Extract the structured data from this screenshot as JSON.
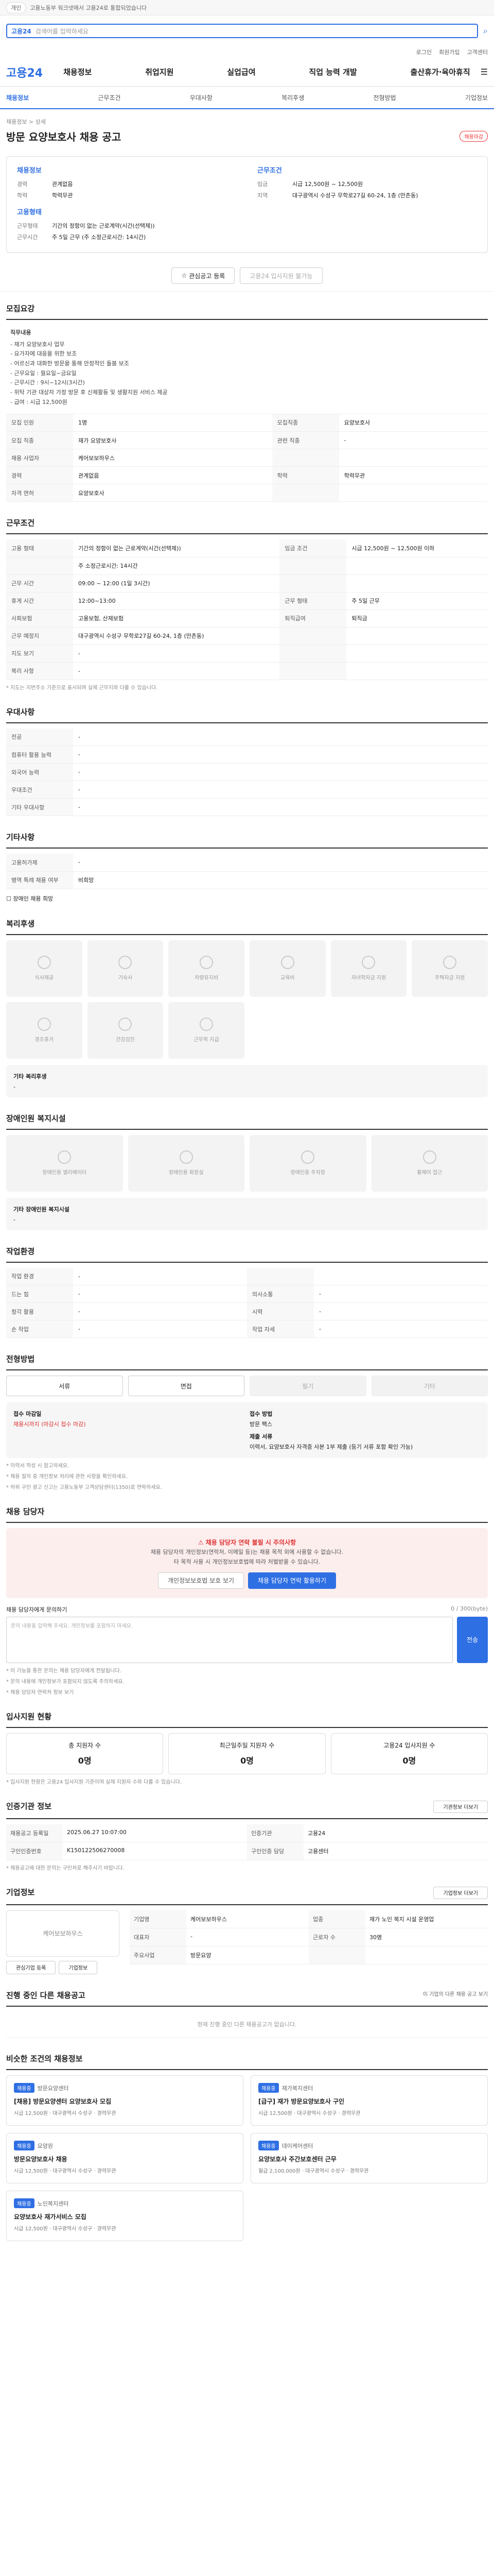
{
  "topbar": {
    "notice": "고용노동부 워크넷에서 고용24로 통합되었습니다",
    "pill": "개인"
  },
  "search": {
    "tag": "고용24",
    "placeholder": "검색어를 입력하세요"
  },
  "toplinks": [
    "로그인",
    "회원가입",
    "고객센터"
  ],
  "nav": {
    "logo": "고용24",
    "items": [
      "채용정보",
      "취업지원",
      "실업급여",
      "직업 능력 개발",
      "출산휴가·육아휴직"
    ]
  },
  "subtabs": [
    "채용정보",
    "근무조건",
    "우대사항",
    "복리후생",
    "전형방법",
    "기업정보"
  ],
  "posting": {
    "crumb": "채용정보 > 상세",
    "title": "방문 요양보호사 채용 공고",
    "badge": "채용마감"
  },
  "info_left": {
    "heading": "채용정보",
    "rows": [
      {
        "k": "경력",
        "v": "관계없음"
      },
      {
        "k": "학력",
        "v": "학력무관"
      }
    ],
    "heading2": "고용형태",
    "rows2": [
      {
        "k": "근무형태",
        "v": "기간의 정함이 없는 근로계약(시간(선택제))"
      },
      {
        "k": "근무시간",
        "v": "주 5일 근무 (주 소정근로시간: 14시간)"
      }
    ]
  },
  "info_right": {
    "heading": "근무조건",
    "rows": [
      {
        "k": "임금",
        "v": "시급 12,500원 ~ 12,500원"
      },
      {
        "k": "지역",
        "v": "대구광역시 수성구 무학로27길 60-24, 1층 (만촌동)"
      }
    ]
  },
  "actions": {
    "scrap": "관심공고 등록",
    "share": "고용24 입사지원 불가능"
  },
  "sec_job": {
    "title": "모집요강",
    "desc_head": "직무내용",
    "desc": [
      "- 재가 요양보호사 업무",
      "- 요가자에 대응을 위한 보조",
      "- 어르신과 대화한 방문을 통해 안정적인 돌봄 보조",
      "- 근무요일 : 월요일~금요일",
      "- 근무시간 : 9시~12시(3시간)",
      "- 위탁 기관 대상자 가정 방문 후 신체활동 및 생활지원 서비스 제공",
      "- 급여 : 시급 12,500원"
    ]
  },
  "job_table": [
    {
      "k": "모집 인원",
      "v": "1명",
      "k2": "모집직종",
      "v2": "요양보호사"
    },
    {
      "k": "모집 직종",
      "v": "재가 요양보호사",
      "k2": "관련 직종",
      "v2": "-"
    },
    {
      "k": "채용 사업자",
      "v": "케어보보하우스",
      "k2": "",
      "v2": ""
    },
    {
      "k": "경력",
      "v": "관계없음",
      "k2": "학력",
      "v2": "학력무관"
    },
    {
      "k": "자격 면허",
      "v": "요양보호사",
      "k2": "",
      "v2": ""
    }
  ],
  "sec_cond": {
    "title": "근무조건"
  },
  "cond_table": [
    {
      "k": "고용 형태",
      "v": "기간의 정함이 없는 근로계약(시간(선택제))",
      "k2": "임금 조건",
      "v2": "시급 12,500원 ~ 12,500원 이하"
    },
    {
      "k": "",
      "v": "주 소정근로시간: 14시간",
      "k2": "",
      "v2": ""
    },
    {
      "k": "근무 시간",
      "v": "09:00 ~ 12:00 (1일 3시간)",
      "k2": "",
      "v2": ""
    },
    {
      "k": "휴게 시간",
      "v": "12:00~13:00",
      "k2": "근무 형태",
      "v2": "주 5일 근무"
    },
    {
      "k": "사회보험",
      "v": "고용보험, 산재보험",
      "k2": "퇴직급여",
      "v2": "퇴직금"
    },
    {
      "k": "근무 예정지",
      "v": "대구광역시 수성구 무학로27길 60-24, 1층 (만촌동)",
      "k2": "",
      "v2": ""
    },
    {
      "k": "지도 보기",
      "v": "-",
      "k2": "",
      "v2": ""
    },
    {
      "k": "복리 사항",
      "v": "-",
      "k2": "",
      "v2": ""
    }
  ],
  "cond_note": "* 지도는 지번주소 기준으로 표시되며 실제 근무지와 다를 수 있습니다.",
  "sec_pref": {
    "title": "우대사항"
  },
  "pref_table": [
    {
      "k": "전공",
      "v": "-"
    },
    {
      "k": "컴퓨터 활용 능력",
      "v": "-"
    },
    {
      "k": "외국어 능력",
      "v": "-"
    },
    {
      "k": "우대조건",
      "v": "-"
    },
    {
      "k": "기타 우대사항",
      "v": "-"
    }
  ],
  "sec_etc": {
    "title": "기타사항"
  },
  "etc_table": [
    {
      "k": "고용허가제",
      "v": "-"
    },
    {
      "k": "병역 특례 채용 여부",
      "v": "비희망"
    }
  ],
  "etc_check": "장애인 채용 희망",
  "sec_welfare": {
    "title": "복리후생"
  },
  "welfare_tiles": [
    "식사제공",
    "기숙사",
    "차량유지비",
    "교육비",
    "자녀학자금 지원",
    "주택자금 지원",
    "경조휴가",
    "건강검진",
    "근무복 지급"
  ],
  "welfare_note_head": "기타 복리후생",
  "welfare_note": "-",
  "sec_disab": {
    "title": "장애인원 복지시설"
  },
  "disab_tiles": [
    "장애인용 엘리베이터",
    "장애인용 화장실",
    "장애인용 주차장",
    "휠체어 접근"
  ],
  "disab_note_head": "기타 장애인원 복지시설",
  "disab_note": "-",
  "sec_env": {
    "title": "작업환경"
  },
  "env_table": [
    {
      "k": "작업 환경",
      "v": "-",
      "k2": "",
      "v2": ""
    },
    {
      "k": "드는 힘",
      "v": "-",
      "k2": "의사소통",
      "v2": "-"
    },
    {
      "k": "청각 활용",
      "v": "-",
      "k2": "시력",
      "v2": "-"
    },
    {
      "k": "손 작업",
      "v": "-",
      "k2": "작업 자세",
      "v2": "-"
    }
  ],
  "sec_method": {
    "title": "전형방법"
  },
  "method_buttons": [
    "서류",
    "면접",
    "필기",
    "기타"
  ],
  "method_info": {
    "k1": "접수 마감일",
    "v1": "채용시까지 (마감시 접수 마감)",
    "k2": "접수 방법",
    "v2": "방문 팩스",
    "k3": "제출 서류",
    "v3": "이력서, 요양보호사 자격증 사본 1부 제출 (등기 서류 포함 확인 가능)"
  },
  "method_notes": [
    "* 이력서 작성 시 참고하세요.",
    "* 채용 절차 중 개인정보 처리에 관한 사항을 확인하세요.",
    "* 허위 구인 광고 신고는 고용노동부 고객상담센터(1350)로 연락하세요."
  ],
  "sec_contact": {
    "title": "채용 담당자"
  },
  "contact_alert": {
    "title": "채용 담당자 연락 불필 시 주의사항",
    "body": "채용 담당자의 개인정보(연락처, 이메일 등)는 채용 목적 외에 사용할 수 없습니다.",
    "body2": "타 목적 사용 시 개인정보보호법에 따라 처벌받을 수 있습니다.",
    "btn1": "개인정보보호법 보호 보기",
    "btn2": "채용 담당자 연락 활용하기"
  },
  "contact_form": {
    "label": "채용 담당자에게 문의하기",
    "counter": "0 / 300(byte)",
    "placeholder": "문의 내용을 입력해 주세요. 개인정보를 포함하지 마세요.",
    "submit": "전송"
  },
  "contact_notes": [
    "* 이 기능을 통한 문의는 채용 담당자에게 전달됩니다.",
    "* 문의 내용에 개인정보가 포함되지 않도록 주의하세요.",
    "* 채용 담당자 연락처 정보 보기"
  ],
  "sec_apply": {
    "title": "입사지원 현황"
  },
  "apply_stats": [
    {
      "k": "총 지원자 수",
      "v": "0명"
    },
    {
      "k": "최근일주일 지원자 수",
      "v": "0명"
    },
    {
      "k": "고용24 입사지원 수",
      "v": "0명"
    }
  ],
  "apply_note": "* 입사지원 현황은 고용24 입사지원 기준이며 실제 지원자 수와 다를 수 있습니다.",
  "sec_mgmt": {
    "title": "인증기관 정보",
    "btn": "기관정보 더보기"
  },
  "mgmt_table": [
    {
      "k": "채용공고 등록일",
      "v": "2025.06.27 10:07:00",
      "k2": "인증기관",
      "v2": "고용24"
    },
    {
      "k": "구인인증번호",
      "v": "K150122506270008",
      "k2": "구인인증 담당",
      "v2": "고용센터"
    }
  ],
  "mgmt_note": "* 채용공고에 대한 문의는 구인처로 해주시기 바랍니다.",
  "sec_company": {
    "title": "기업정보",
    "btn": "기업정보 더보기"
  },
  "company_logo": "케어보보하우스",
  "company_table": [
    {
      "k": "기업명",
      "v": "케어보보하우스",
      "k2": "업종",
      "v2": "재가 노인 복지 시설 운영업"
    },
    {
      "k": "대표자",
      "v": "-",
      "k2": "근로자 수",
      "v2": "30명"
    },
    {
      "k": "주요사업",
      "v": "방문요양",
      "k2": "",
      "v2": ""
    }
  ],
  "company_btns": [
    "관심기업 등록",
    "기업정보"
  ],
  "sec_other": {
    "title": "진행 중인 다른 채용공고",
    "note": "현재 진행 중인 다른 채용공고가 없습니다.",
    "more": "이 기업의 다른 채용 공고 보기"
  },
  "sec_similar": {
    "title": "비슷한 조건의 채용정보"
  },
  "similar_cards": [
    {
      "tag": "채용중",
      "co": "방문요양센터",
      "title": "[채용] 방문요양센터 요양보호사 모집",
      "meta": [
        "시급 12,500원",
        "대구광역시 수성구",
        "경력무관"
      ]
    },
    {
      "tag": "채용중",
      "co": "재가복지센터",
      "title": "[급구] 재가 방문요양보호사 구인",
      "meta": [
        "시급 12,500원",
        "대구광역시 수성구",
        "경력무관"
      ]
    },
    {
      "tag": "채용중",
      "co": "요양원",
      "title": "방문요양보호사 채용",
      "meta": [
        "시급 12,500원",
        "대구광역시 수성구",
        "경력무관"
      ]
    },
    {
      "tag": "채용중",
      "co": "데이케어센터",
      "title": "요양보호사 주간보호센터 근무",
      "meta": [
        "월급 2,100,000원",
        "대구광역시 수성구",
        "경력무관"
      ]
    },
    {
      "tag": "채용중",
      "co": "노인복지센터",
      "title": "요양보호사 재가서비스 모집",
      "meta": [
        "시급 12,500원",
        "대구광역시 수성구",
        "경력무관"
      ]
    }
  ]
}
